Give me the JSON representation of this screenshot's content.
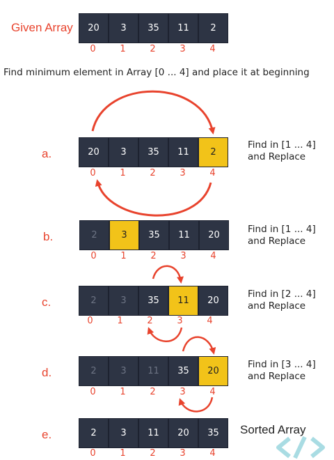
{
  "title": "Given Array",
  "description": "Find minimum element in Array [0 ... 4] and place it at beginning",
  "indices": [
    "0",
    "1",
    "2",
    "3",
    "4"
  ],
  "given": [
    "20",
    "3",
    "35",
    "11",
    "2"
  ],
  "rows": [
    {
      "label": "a.",
      "values": [
        "20",
        "3",
        "35",
        "11",
        "2"
      ],
      "highlight": [
        4
      ],
      "done": [],
      "note1": "Find in [1 ... 4]",
      "note2": "and Replace"
    },
    {
      "label": "b.",
      "values": [
        "2",
        "3",
        "35",
        "11",
        "20"
      ],
      "highlight": [
        1
      ],
      "done": [
        0
      ],
      "note1": "Find in [1 ... 4]",
      "note2": "and Replace"
    },
    {
      "label": "c.",
      "values": [
        "2",
        "3",
        "35",
        "11",
        "20"
      ],
      "highlight": [
        3
      ],
      "done": [
        0,
        1
      ],
      "note1": "Find in [2 ... 4]",
      "note2": "and Replace"
    },
    {
      "label": "d.",
      "values": [
        "2",
        "3",
        "11",
        "35",
        "20"
      ],
      "highlight": [
        4
      ],
      "done": [
        0,
        1,
        2
      ],
      "note1": "Find in [3 ... 4]",
      "note2": "and Replace"
    },
    {
      "label": "e.",
      "values": [
        "2",
        "3",
        "11",
        "20",
        "35"
      ],
      "highlight": [],
      "done": []
    }
  ],
  "sorted_label": "Sorted Array",
  "colors": {
    "accent": "#e8432d",
    "cell": "#2d3444",
    "highlight": "#f2c319"
  },
  "logo_icon": "code-brackets-icon"
}
